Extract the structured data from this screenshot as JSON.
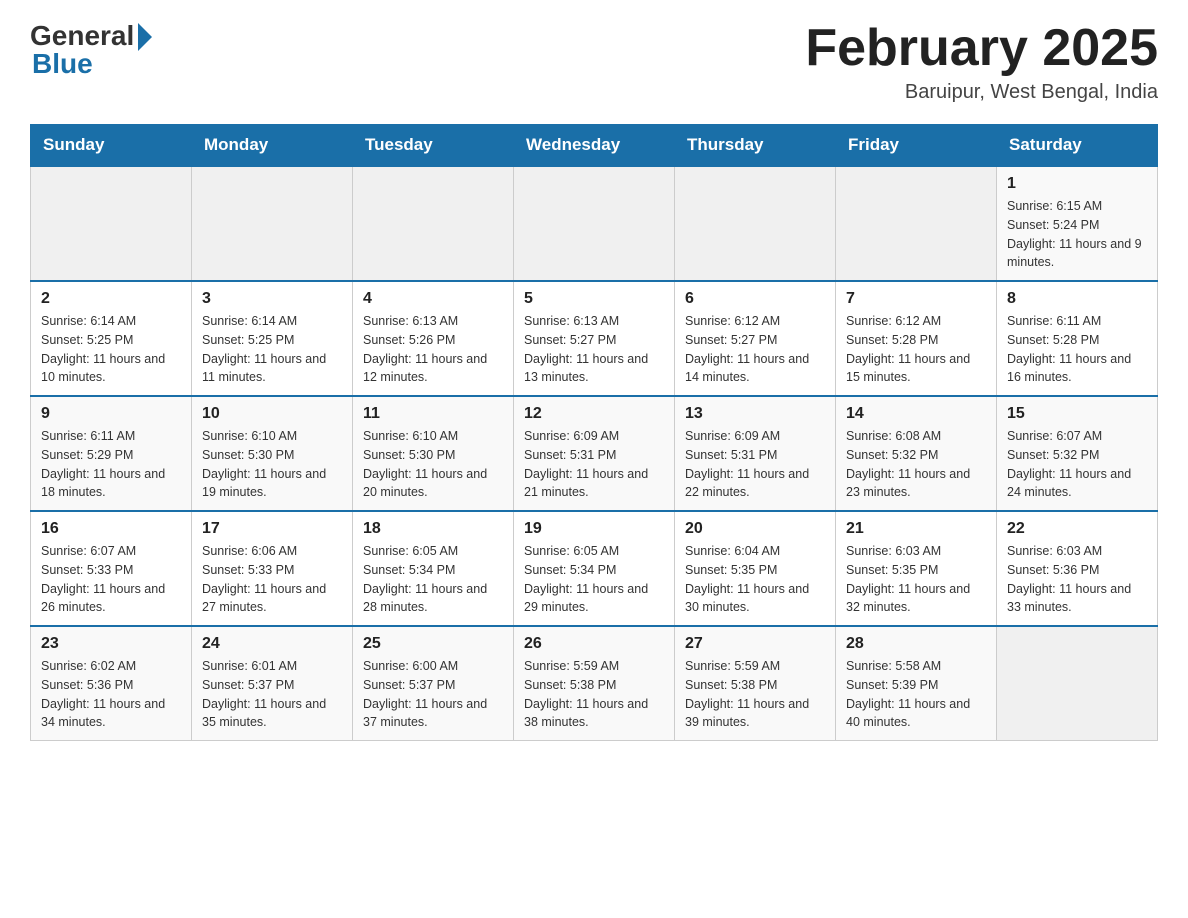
{
  "header": {
    "logo_general": "General",
    "logo_blue": "Blue",
    "title": "February 2025",
    "location": "Baruipur, West Bengal, India"
  },
  "days_of_week": [
    "Sunday",
    "Monday",
    "Tuesday",
    "Wednesday",
    "Thursday",
    "Friday",
    "Saturday"
  ],
  "weeks": [
    [
      {
        "day": "",
        "info": ""
      },
      {
        "day": "",
        "info": ""
      },
      {
        "day": "",
        "info": ""
      },
      {
        "day": "",
        "info": ""
      },
      {
        "day": "",
        "info": ""
      },
      {
        "day": "",
        "info": ""
      },
      {
        "day": "1",
        "info": "Sunrise: 6:15 AM\nSunset: 5:24 PM\nDaylight: 11 hours and 9 minutes."
      }
    ],
    [
      {
        "day": "2",
        "info": "Sunrise: 6:14 AM\nSunset: 5:25 PM\nDaylight: 11 hours and 10 minutes."
      },
      {
        "day": "3",
        "info": "Sunrise: 6:14 AM\nSunset: 5:25 PM\nDaylight: 11 hours and 11 minutes."
      },
      {
        "day": "4",
        "info": "Sunrise: 6:13 AM\nSunset: 5:26 PM\nDaylight: 11 hours and 12 minutes."
      },
      {
        "day": "5",
        "info": "Sunrise: 6:13 AM\nSunset: 5:27 PM\nDaylight: 11 hours and 13 minutes."
      },
      {
        "day": "6",
        "info": "Sunrise: 6:12 AM\nSunset: 5:27 PM\nDaylight: 11 hours and 14 minutes."
      },
      {
        "day": "7",
        "info": "Sunrise: 6:12 AM\nSunset: 5:28 PM\nDaylight: 11 hours and 15 minutes."
      },
      {
        "day": "8",
        "info": "Sunrise: 6:11 AM\nSunset: 5:28 PM\nDaylight: 11 hours and 16 minutes."
      }
    ],
    [
      {
        "day": "9",
        "info": "Sunrise: 6:11 AM\nSunset: 5:29 PM\nDaylight: 11 hours and 18 minutes."
      },
      {
        "day": "10",
        "info": "Sunrise: 6:10 AM\nSunset: 5:30 PM\nDaylight: 11 hours and 19 minutes."
      },
      {
        "day": "11",
        "info": "Sunrise: 6:10 AM\nSunset: 5:30 PM\nDaylight: 11 hours and 20 minutes."
      },
      {
        "day": "12",
        "info": "Sunrise: 6:09 AM\nSunset: 5:31 PM\nDaylight: 11 hours and 21 minutes."
      },
      {
        "day": "13",
        "info": "Sunrise: 6:09 AM\nSunset: 5:31 PM\nDaylight: 11 hours and 22 minutes."
      },
      {
        "day": "14",
        "info": "Sunrise: 6:08 AM\nSunset: 5:32 PM\nDaylight: 11 hours and 23 minutes."
      },
      {
        "day": "15",
        "info": "Sunrise: 6:07 AM\nSunset: 5:32 PM\nDaylight: 11 hours and 24 minutes."
      }
    ],
    [
      {
        "day": "16",
        "info": "Sunrise: 6:07 AM\nSunset: 5:33 PM\nDaylight: 11 hours and 26 minutes."
      },
      {
        "day": "17",
        "info": "Sunrise: 6:06 AM\nSunset: 5:33 PM\nDaylight: 11 hours and 27 minutes."
      },
      {
        "day": "18",
        "info": "Sunrise: 6:05 AM\nSunset: 5:34 PM\nDaylight: 11 hours and 28 minutes."
      },
      {
        "day": "19",
        "info": "Sunrise: 6:05 AM\nSunset: 5:34 PM\nDaylight: 11 hours and 29 minutes."
      },
      {
        "day": "20",
        "info": "Sunrise: 6:04 AM\nSunset: 5:35 PM\nDaylight: 11 hours and 30 minutes."
      },
      {
        "day": "21",
        "info": "Sunrise: 6:03 AM\nSunset: 5:35 PM\nDaylight: 11 hours and 32 minutes."
      },
      {
        "day": "22",
        "info": "Sunrise: 6:03 AM\nSunset: 5:36 PM\nDaylight: 11 hours and 33 minutes."
      }
    ],
    [
      {
        "day": "23",
        "info": "Sunrise: 6:02 AM\nSunset: 5:36 PM\nDaylight: 11 hours and 34 minutes."
      },
      {
        "day": "24",
        "info": "Sunrise: 6:01 AM\nSunset: 5:37 PM\nDaylight: 11 hours and 35 minutes."
      },
      {
        "day": "25",
        "info": "Sunrise: 6:00 AM\nSunset: 5:37 PM\nDaylight: 11 hours and 37 minutes."
      },
      {
        "day": "26",
        "info": "Sunrise: 5:59 AM\nSunset: 5:38 PM\nDaylight: 11 hours and 38 minutes."
      },
      {
        "day": "27",
        "info": "Sunrise: 5:59 AM\nSunset: 5:38 PM\nDaylight: 11 hours and 39 minutes."
      },
      {
        "day": "28",
        "info": "Sunrise: 5:58 AM\nSunset: 5:39 PM\nDaylight: 11 hours and 40 minutes."
      },
      {
        "day": "",
        "info": ""
      }
    ]
  ]
}
